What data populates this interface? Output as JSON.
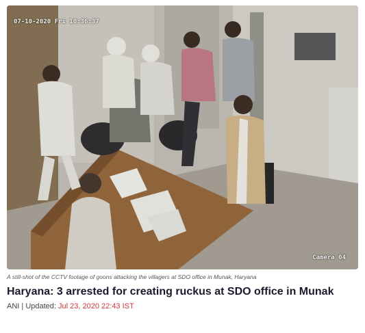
{
  "image": {
    "timestamp_overlay": "07-10-2020 Fri 10:36:37",
    "camera_overlay": "Camera 04",
    "caption": "A still-shot of the CCTV footage of goons attacking the villagers at SDO office in Munak, Haryana"
  },
  "article": {
    "title": "Haryana: 3 arrested for creating ruckus at SDO office in Munak",
    "source": "ANI",
    "updated_label": "| Updated:",
    "date": "Jul 23, 2020 22:43 IST"
  },
  "colors": {
    "accent_date": "#d0353a",
    "headline": "#1a1a2e"
  }
}
